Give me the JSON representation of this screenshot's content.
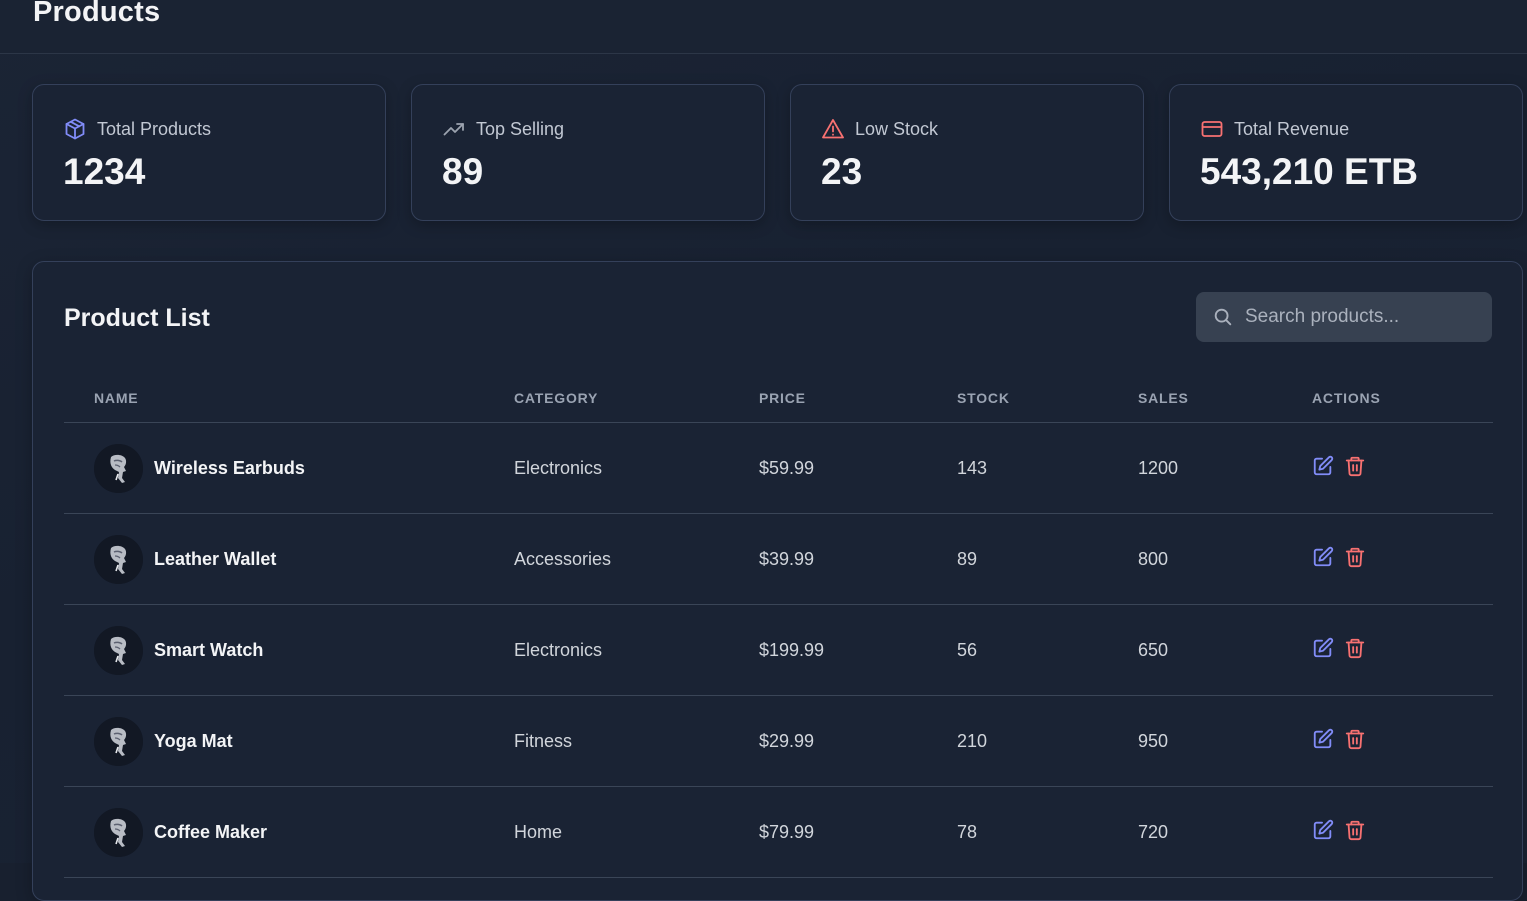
{
  "header": {
    "title": "Products"
  },
  "stats": [
    {
      "label": "Total Products",
      "value": "1234",
      "icon": "cube-icon",
      "color": "#818cf8"
    },
    {
      "label": "Top Selling",
      "value": "89",
      "icon": "trending-up-icon",
      "color": "#9ca3af"
    },
    {
      "label": "Low Stock",
      "value": "23",
      "icon": "warning-triangle-icon",
      "color": "#f87171"
    },
    {
      "label": "Total Revenue",
      "value": "543,210 ETB",
      "icon": "credit-card-icon",
      "color": "#f87171"
    }
  ],
  "product_list": {
    "title": "Product List",
    "search": {
      "placeholder": "Search products...",
      "value": ""
    },
    "columns": [
      "Name",
      "Category",
      "Price",
      "Stock",
      "Sales",
      "Actions"
    ],
    "rows": [
      {
        "name": "Wireless Earbuds",
        "category": "Electronics",
        "price": "$59.99",
        "stock": "143",
        "sales": "1200"
      },
      {
        "name": "Leather Wallet",
        "category": "Accessories",
        "price": "$39.99",
        "stock": "89",
        "sales": "800"
      },
      {
        "name": "Smart Watch",
        "category": "Electronics",
        "price": "$199.99",
        "stock": "56",
        "sales": "650"
      },
      {
        "name": "Yoga Mat",
        "category": "Fitness",
        "price": "$29.99",
        "stock": "210",
        "sales": "950"
      },
      {
        "name": "Coffee Maker",
        "category": "Home",
        "price": "$79.99",
        "stock": "78",
        "sales": "720"
      }
    ]
  },
  "colors": {
    "accent": "#818cf8",
    "danger": "#f87171",
    "background": "#18202f",
    "card": "#1a2334"
  }
}
